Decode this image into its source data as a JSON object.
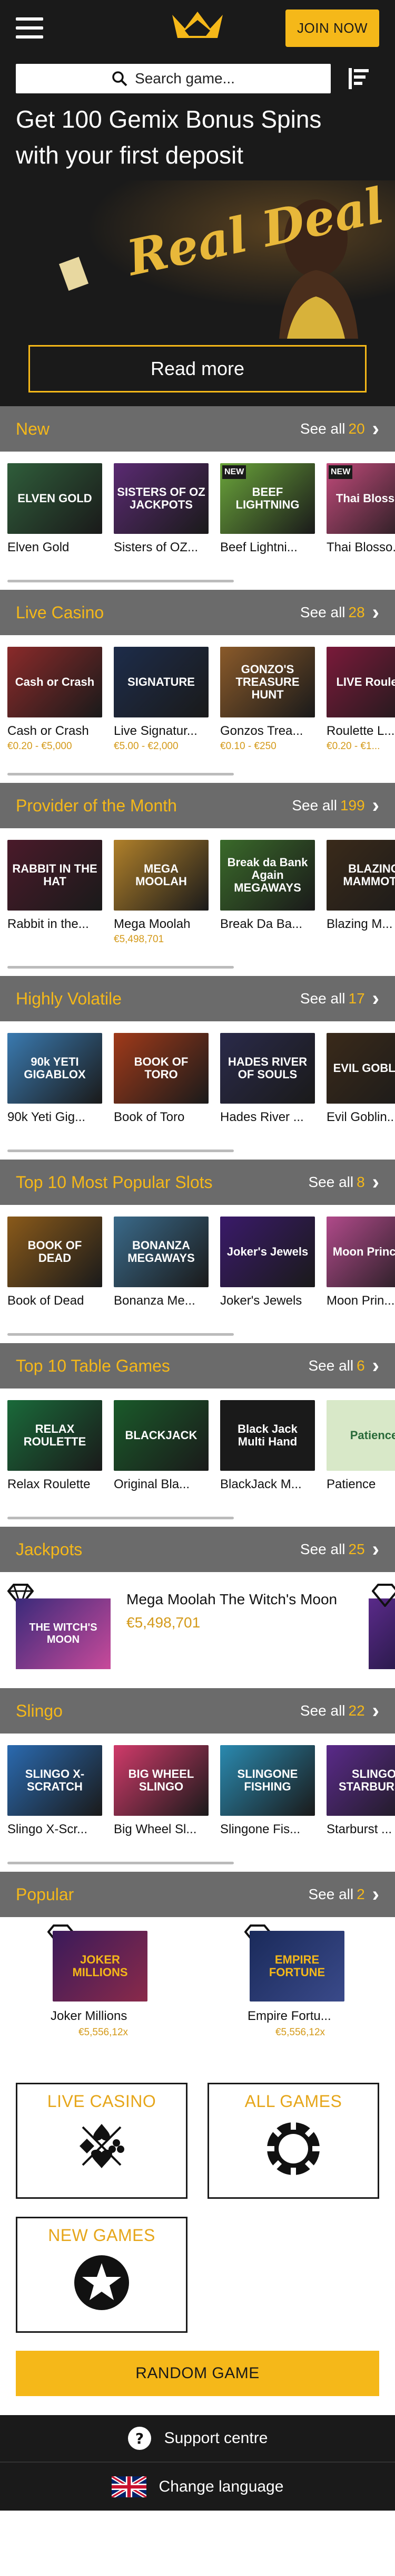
{
  "header": {
    "join_label": "JOIN NOW"
  },
  "search": {
    "placeholder": "Search game..."
  },
  "hero": {
    "title_line1": "Get 100 Gemix Bonus Spins",
    "title_line2": "with your first deposit",
    "art_text": "Real Deal",
    "read_more": "Read more"
  },
  "sections": {
    "new": {
      "title": "New",
      "see_all": "See all",
      "count": "20",
      "games": [
        {
          "name": "Elven Gold",
          "art": "ELVEN GOLD",
          "color": "#2f5d3a"
        },
        {
          "name": "Sisters of OZ...",
          "art": "SISTERS OF OZ JACKPOTS",
          "color": "#5a2a72"
        },
        {
          "name": "Beef Lightni...",
          "art": "BEEF LIGHTNING",
          "color": "#6aa43a",
          "badge": "NEW"
        },
        {
          "name": "Thai Blosso...",
          "art": "Thai Blossom",
          "color": "#c04a7a",
          "badge": "NEW"
        }
      ]
    },
    "live_casino": {
      "title": "Live Casino",
      "see_all": "See all",
      "count": "28",
      "games": [
        {
          "name": "Cash or Crash",
          "sub": "€0.20 - €5,000",
          "art": "Cash or Crash",
          "color": "#8a2a2a"
        },
        {
          "name": "Live Signatur...",
          "sub": "€5.00 - €2,000",
          "art": "SIGNATURE",
          "color": "#1d2c4a"
        },
        {
          "name": "Gonzos Trea...",
          "sub": "€0.10 - €250",
          "art": "GONZO'S TREASURE HUNT",
          "color": "#8a5a2a"
        },
        {
          "name": "Roulette L...",
          "sub": "€0.20 - €1...",
          "art": "LIVE Roulette",
          "color": "#7a1a3a"
        }
      ]
    },
    "provider": {
      "title": "Provider of the Month",
      "see_all": "See all",
      "count": "199",
      "games": [
        {
          "name": "Rabbit in the...",
          "art": "RABBIT IN THE HAT",
          "color": "#4a1a2a"
        },
        {
          "name": "Mega Moolah",
          "sub": "€5,498,701",
          "art": "MEGA MOOLAH",
          "color": "#b0802a"
        },
        {
          "name": "Break Da Ba...",
          "art": "Break da Bank Again MEGAWAYS",
          "color": "#3a6a2a"
        },
        {
          "name": "Blazing M...",
          "art": "BLAZING MAMMOTH",
          "color": "#3a2a1a"
        }
      ]
    },
    "volatile": {
      "title": "Highly Volatile",
      "see_all": "See all",
      "count": "17",
      "games": [
        {
          "name": "90k Yeti Gig...",
          "art": "90k YETI GIGABLOX",
          "color": "#3a7ab0"
        },
        {
          "name": "Book of Toro",
          "art": "BOOK OF TORO",
          "color": "#a03a1a"
        },
        {
          "name": "Hades River ...",
          "art": "HADES RIVER OF SOULS",
          "color": "#2a2a4a"
        },
        {
          "name": "Evil Goblin...",
          "art": "EVIL GOBLINS",
          "color": "#3a2a1a"
        }
      ]
    },
    "top10slots": {
      "title": "Top 10 Most Popular Slots",
      "see_all": "See all",
      "count": "8",
      "games": [
        {
          "name": "Book of Dead",
          "art": "BOOK OF DEAD",
          "color": "#8a5a1a"
        },
        {
          "name": "Bonanza Me...",
          "art": "BONANZA MEGAWAYS",
          "color": "#3a6a8a"
        },
        {
          "name": "Joker's Jewels",
          "art": "Joker's Jewels",
          "color": "#3a1a6a"
        },
        {
          "name": "Moon Prin...",
          "art": "Moon Princess",
          "color": "#b04a8a"
        }
      ]
    },
    "top10table": {
      "title": "Top 10 Table Games",
      "see_all": "See all",
      "count": "6",
      "games": [
        {
          "name": "Relax Roulette",
          "art": "RELAX ROULETTE",
          "color": "#1a6a3a"
        },
        {
          "name": "Original Bla...",
          "art": "BLACKJACK",
          "color": "#1a5a2a"
        },
        {
          "name": "BlackJack M...",
          "art": "Black Jack Multi Hand",
          "color": "#1a1a1a"
        },
        {
          "name": "Patience",
          "art": "Patience",
          "color": "#d8e8c8"
        }
      ]
    },
    "jackpots": {
      "title": "Jackpots",
      "see_all": "See all",
      "count": "25",
      "item": {
        "name": "Mega Moolah The Witch's Moon",
        "value": "€5,498,701",
        "art": "THE WITCH'S MOON"
      }
    },
    "slingo": {
      "title": "Slingo",
      "see_all": "See all",
      "count": "22",
      "games": [
        {
          "name": "Slingo X-Scr...",
          "art": "SLINGO X-SCRATCH",
          "color": "#2a6ab0"
        },
        {
          "name": "Big Wheel Sl...",
          "art": "BIG WHEEL SLINGO",
          "color": "#d03a6a"
        },
        {
          "name": "Slingone Fis...",
          "art": "SLINGONE FISHING",
          "color": "#2a8ab0"
        },
        {
          "name": "Starburst ...",
          "art": "SLINGO STARBURST",
          "color": "#5a2a8a"
        }
      ]
    },
    "popular": {
      "title": "Popular",
      "see_all": "See all",
      "count": "2",
      "games": [
        {
          "name": "Joker Millions",
          "sub": "€5,556,12x",
          "art": "JOKER MILLIONS"
        },
        {
          "name": "Empire Fortu...",
          "sub": "€5,556,12x",
          "art": "EMPIRE FORTUNE"
        }
      ]
    }
  },
  "tiles": {
    "live_casino": "LIVE CASINO",
    "all_games": "ALL GAMES",
    "new_games": "NEW GAMES",
    "random": "RANDOM GAME"
  },
  "footer": {
    "support": "Support centre",
    "language": "Change language"
  },
  "colors": {
    "accent": "#f5b819",
    "dark": "#1a1a1a",
    "section": "#6b6b6b"
  }
}
